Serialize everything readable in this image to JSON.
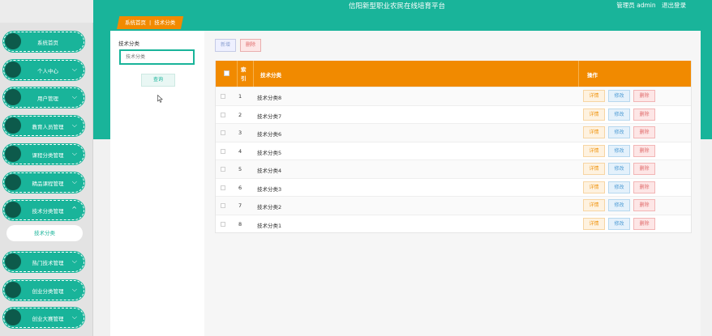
{
  "header": {
    "site_title": "信阳新型职业农民在线培育平台",
    "user_label": "管理员 admin",
    "logout_label": "退出登录"
  },
  "breadcrumb": {
    "home": "系统首页",
    "separator": "|",
    "current": "技术分类"
  },
  "sidebar": {
    "items": [
      {
        "label": "系统首页",
        "chevron": ""
      },
      {
        "label": "个人中心",
        "chevron": "⌵"
      },
      {
        "label": "用户管理",
        "chevron": "⌵"
      },
      {
        "label": "教育人员管理",
        "chevron": "⌵"
      },
      {
        "label": "课程分类管理",
        "chevron": "⌵"
      },
      {
        "label": "精品课程管理",
        "chevron": "⌵"
      },
      {
        "label": "技术分类管理",
        "chevron": "^"
      },
      {
        "label": "热门技术管理",
        "chevron": "⌵"
      },
      {
        "label": "创业分类管理",
        "chevron": "⌵"
      },
      {
        "label": "创业大赛管理",
        "chevron": "⌵"
      }
    ],
    "submenu_label": "技术分类"
  },
  "search": {
    "label": "技术分类",
    "placeholder": "技术分类",
    "button_label": "查询"
  },
  "toolbar": {
    "add_label": "新增",
    "delete_label": "删除"
  },
  "table": {
    "headers": {
      "index": "索引",
      "name": "技术分类",
      "actions": "操作"
    },
    "rows": [
      {
        "index": "1",
        "name": "技术分类8"
      },
      {
        "index": "2",
        "name": "技术分类7"
      },
      {
        "index": "3",
        "name": "技术分类6"
      },
      {
        "index": "4",
        "name": "技术分类5"
      },
      {
        "index": "5",
        "name": "技术分类4"
      },
      {
        "index": "6",
        "name": "技术分类3"
      },
      {
        "index": "7",
        "name": "技术分类2"
      },
      {
        "index": "8",
        "name": "技术分类1"
      }
    ],
    "row_actions": {
      "detail": "详情",
      "edit": "修改",
      "delete": "删除"
    }
  },
  "colors": {
    "primary": "#19b49a",
    "accent": "#f18a00",
    "danger": "#e06b6b",
    "info": "#4d9bd4"
  },
  "icons": {
    "menu_dot": "circle-icon",
    "cursor": "mouse-pointer-icon"
  }
}
